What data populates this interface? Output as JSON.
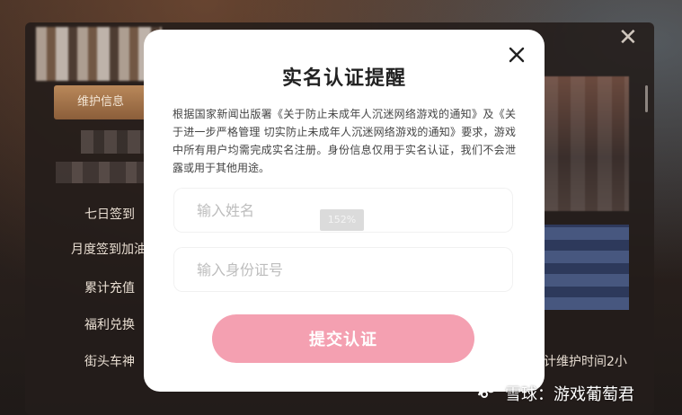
{
  "background": {
    "tab_label": "维护信息",
    "menu_items": [
      "七日签到",
      "月度签到加油站",
      "累计充值",
      "福利兑换",
      "街头车神"
    ],
    "right_text": "计维护时间2小"
  },
  "modal": {
    "title": "实名认证提醒",
    "notice": "根据国家新闻出版署《关于防止未成年人沉迷网络游戏的通知》及《关于进一步严格管理 切实防止未成年人沉迷网络游戏的通知》要求，游戏中所有用户均需完成实名注册。身份信息仅用于实名认证，我们不会泄露或用于其他用途。",
    "name_placeholder": "输入姓名",
    "id_placeholder": "输入身份证号",
    "submit_label": "提交认证",
    "zoom_badge": "152%"
  },
  "watermark": {
    "text": "雪球：游戏葡萄君"
  },
  "colors": {
    "submit_bg": "#f4a0b1",
    "modal_bg": "#ffffff",
    "title": "#222222"
  }
}
